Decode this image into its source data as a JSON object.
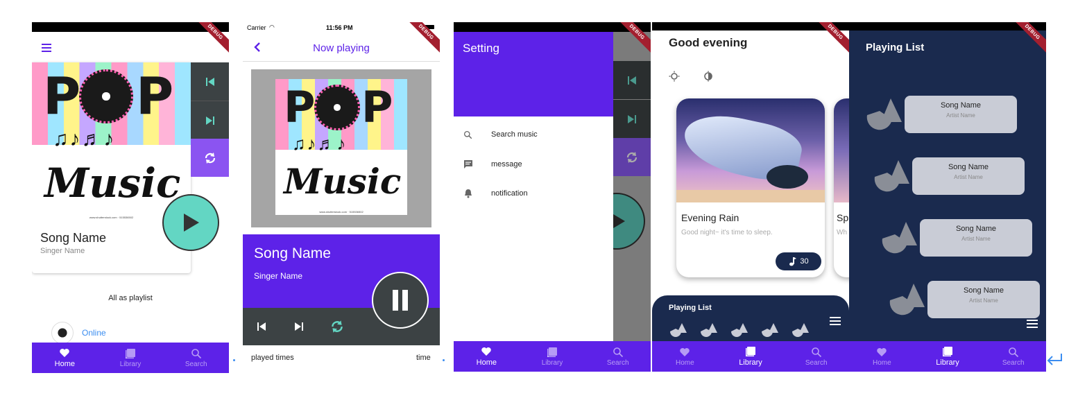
{
  "screens": {
    "home": {
      "song_title": "Song Name",
      "singer": "Singer Name",
      "section_label": "All as playlist",
      "playlist_item": "Online",
      "art": {
        "top_left": "P",
        "top_right": "P",
        "word": "Music",
        "notes": "♫♪♬♪",
        "credit": "www.shutterstock.com · 515536502"
      }
    },
    "now_playing": {
      "carrier": "Carrier",
      "time": "11:56 PM",
      "title": "Now playing",
      "song_title": "Song Name",
      "singer": "Singer Name",
      "played_times_label": "played times",
      "time_label": "time",
      "art": {
        "top_left": "P",
        "top_right": "P",
        "word": "Music",
        "notes": "♫♪♬♪",
        "credit": "www.shutterstock.com · 515536502"
      }
    },
    "setting": {
      "header": "Setting",
      "menu": [
        {
          "label": "Search music",
          "icon": "search-icon"
        },
        {
          "label": "message",
          "icon": "message-icon"
        },
        {
          "label": "notification",
          "icon": "bell-icon"
        }
      ]
    },
    "library": {
      "greeting": "Good evening",
      "card": {
        "title": "Evening Rain",
        "subtitle": "Good night~ it's time to sleep.",
        "count": "30"
      },
      "next_card": {
        "title_fragment": "Sp",
        "subtitle_fragment": "Wh"
      },
      "playing_list_label": "Playing List"
    },
    "playing_list": {
      "title": "Playing List",
      "items": [
        {
          "song": "Song Name",
          "artist": "Artist Name"
        },
        {
          "song": "Song Name",
          "artist": "Artist Name"
        },
        {
          "song": "Song Name",
          "artist": "Artist Name"
        },
        {
          "song": "Song Name",
          "artist": "Artist Name"
        }
      ]
    }
  },
  "debug_banner": "DEBUG",
  "nav": {
    "home": "Home",
    "library": "Library",
    "search": "Search"
  },
  "colors": {
    "accent": "#5d22e8",
    "navy": "#1a2a4e",
    "teal": "#63d6c3",
    "purple_light": "#8b54f1",
    "dark_gray": "#3c4244"
  }
}
